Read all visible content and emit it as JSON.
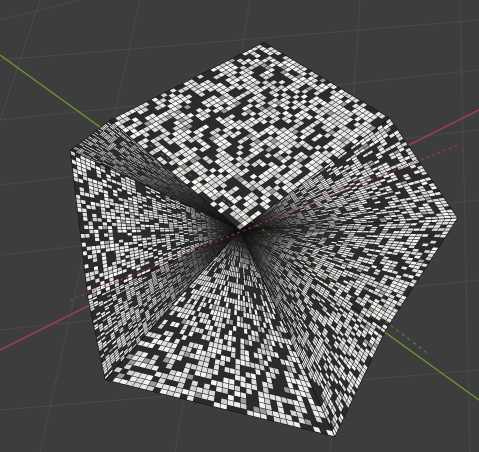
{
  "viewport": {
    "background_color": "#3d3d3d",
    "grid_color": "#4a4a4a",
    "x_axis_color": "#a8404e",
    "y_axis_color": "#6f9a2a"
  },
  "mesh": {
    "shape": "pentagonal polyhedron (subdivided, randomly deleted faces)",
    "tile_color": "#eaeaea",
    "wire_color": "#0b0b0b",
    "hole_color": "#2b2b2b"
  }
}
